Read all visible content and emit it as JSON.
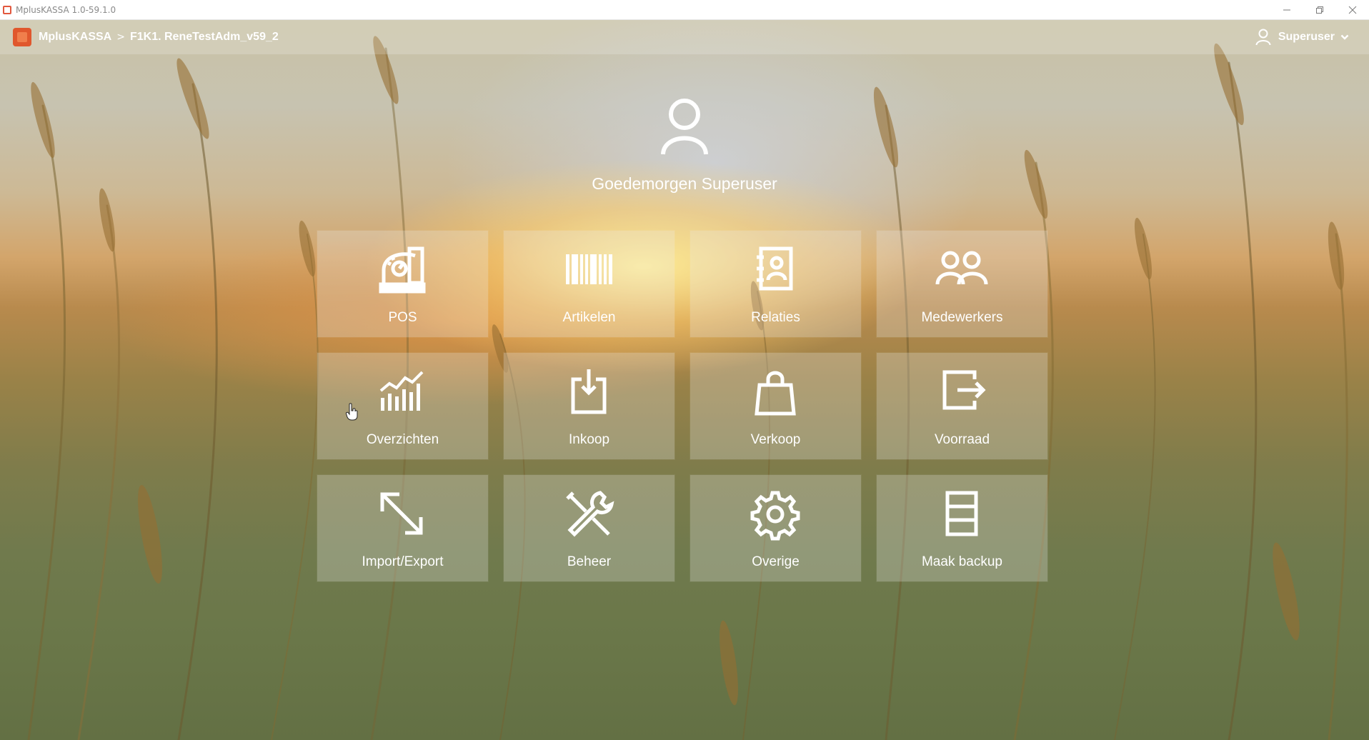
{
  "window": {
    "title": "MplusKASSA 1.0-59.1.0",
    "controls": [
      "minimize-icon",
      "restore-icon",
      "close-icon"
    ]
  },
  "header": {
    "app_name": "MplusKASSA",
    "separator": ">",
    "location": "F1K1. ReneTestAdm_v59_2",
    "user": "Superuser",
    "user_icon": "user-icon",
    "chevron_icon": "chevron-down-icon"
  },
  "greeting": {
    "icon": "user-icon",
    "text": "Goedemorgen Superuser"
  },
  "tiles": [
    {
      "label": "POS",
      "icon": "cash-register-icon"
    },
    {
      "label": "Artikelen",
      "icon": "barcode-icon"
    },
    {
      "label": "Relaties",
      "icon": "contact-book-icon"
    },
    {
      "label": "Medewerkers",
      "icon": "users-icon"
    },
    {
      "label": "Overzichten",
      "icon": "chart-icon"
    },
    {
      "label": "Inkoop",
      "icon": "inbox-download-icon"
    },
    {
      "label": "Verkoop",
      "icon": "shopping-bag-icon"
    },
    {
      "label": "Voorraad",
      "icon": "export-box-icon"
    },
    {
      "label": "Import/Export",
      "icon": "import-export-icon"
    },
    {
      "label": "Beheer",
      "icon": "tools-icon"
    },
    {
      "label": "Overige",
      "icon": "gear-icon"
    },
    {
      "label": "Maak backup",
      "icon": "backup-icon"
    }
  ],
  "colors": {
    "brand": "#e0572d",
    "tile_bg": "rgba(235,235,235,0.27)",
    "text": "#ffffff"
  }
}
